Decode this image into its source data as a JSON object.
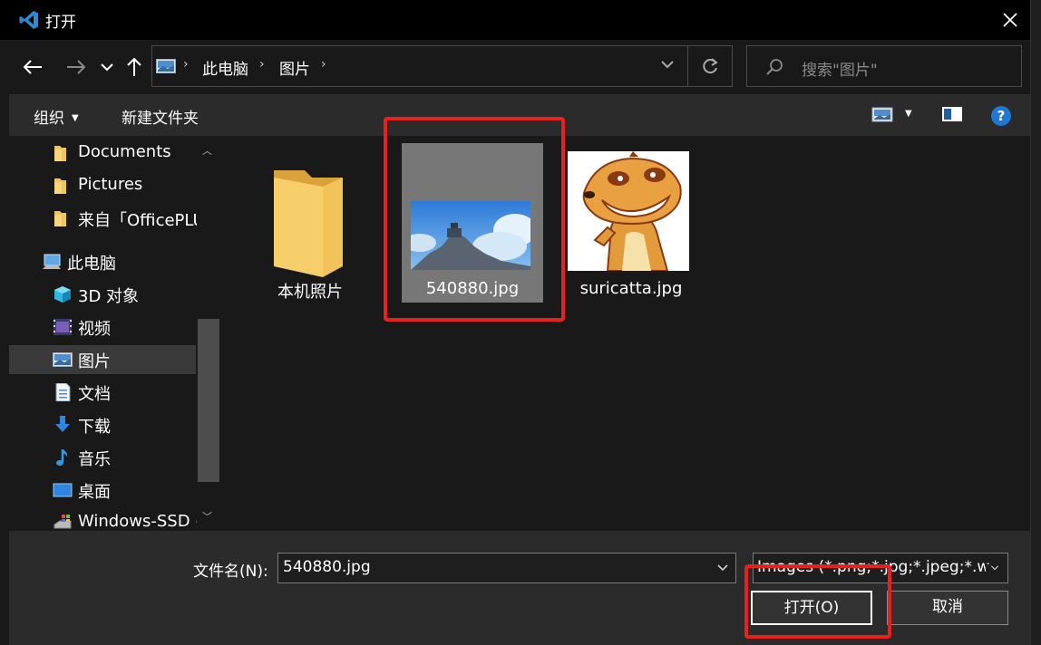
{
  "window": {
    "title": "打开"
  },
  "address": {
    "crumbs": [
      "此电脑",
      "图片"
    ]
  },
  "search": {
    "placeholder": "搜索\"图片\""
  },
  "toolbar": {
    "organize": "组织",
    "new_folder": "新建文件夹"
  },
  "nav": {
    "items": [
      {
        "label": "Documents",
        "icon": "folder-icon"
      },
      {
        "label": "Pictures",
        "icon": "folder-icon"
      },
      {
        "label": "来自「OfficePLU",
        "icon": "folder-icon"
      },
      {
        "label": "此电脑",
        "icon": "computer-icon"
      },
      {
        "label": "3D 对象",
        "icon": "3d-objects-icon"
      },
      {
        "label": "视频",
        "icon": "video-icon"
      },
      {
        "label": "图片",
        "icon": "pictures-icon",
        "selected": true
      },
      {
        "label": "文档",
        "icon": "document-icon"
      },
      {
        "label": "下载",
        "icon": "download-icon"
      },
      {
        "label": "音乐",
        "icon": "music-icon"
      },
      {
        "label": "桌面",
        "icon": "desktop-icon"
      },
      {
        "label": "Windows-SSD (",
        "icon": "drive-icon"
      }
    ]
  },
  "files": [
    {
      "name": "本机照片",
      "type": "folder"
    },
    {
      "name": "540880.jpg",
      "type": "image",
      "selected": true
    },
    {
      "name": "suricatta.jpg",
      "type": "image"
    }
  ],
  "footer": {
    "filename_label": "文件名(N):",
    "filename_value": "540880.jpg",
    "filetype_value": "Images (*.png;*.jpg;*.jpeg;*.w",
    "open_label": "打开(O)",
    "cancel_label": "取消"
  },
  "colors": {
    "highlight": "#e8201e",
    "selection": "#777777",
    "accent": "#0078d4"
  }
}
